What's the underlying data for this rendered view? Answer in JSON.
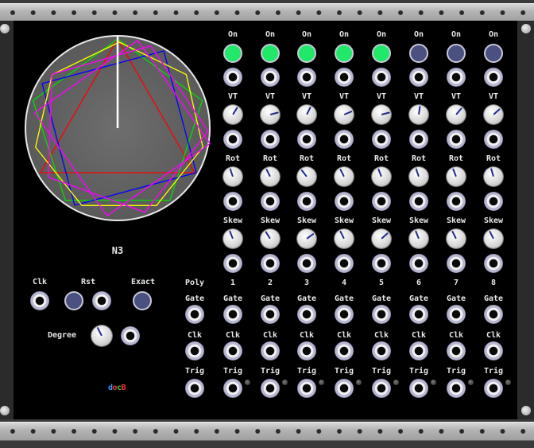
{
  "module": {
    "name": "N3"
  },
  "top_labels": [
    "On",
    "VT",
    "Rot",
    "Skew"
  ],
  "poly_label": "Poly",
  "channel_numbers": [
    "1",
    "2",
    "3",
    "4",
    "5",
    "6",
    "7",
    "8"
  ],
  "bottom_row_labels": [
    "Gate",
    "Clk",
    "Trig"
  ],
  "controls": {
    "clk": "Clk",
    "rst": "Rst",
    "exact": "Exact",
    "degree": "Degree"
  },
  "on_states": [
    true,
    true,
    true,
    true,
    true,
    false,
    false,
    false
  ],
  "knob_values": {
    "vt": [
      0.38,
      0.22,
      0.4,
      0.25,
      0.22,
      0.47,
      0.35,
      0.32
    ],
    "rot": [
      0.57,
      0.6,
      0.64,
      0.6,
      0.58,
      0.57,
      0.58,
      0.56
    ],
    "skew": [
      0.58,
      0.62,
      0.3,
      0.6,
      0.32,
      0.58,
      0.6,
      0.6
    ],
    "degree": 0.6
  },
  "logo": "docB",
  "colors": {
    "on_active": "#22e86a",
    "on_inactive": "#4a5080",
    "knob_pointer": "#1d2b8c",
    "polygon_colors": [
      "#ff0000",
      "#00dd00",
      "#0000ff",
      "#ffff00",
      "#ff00ff",
      "#ff00ff"
    ],
    "clock_hand": "#ffffff"
  },
  "icons": [
    "polygon-display",
    "jack",
    "knob",
    "push-button",
    "led"
  ]
}
